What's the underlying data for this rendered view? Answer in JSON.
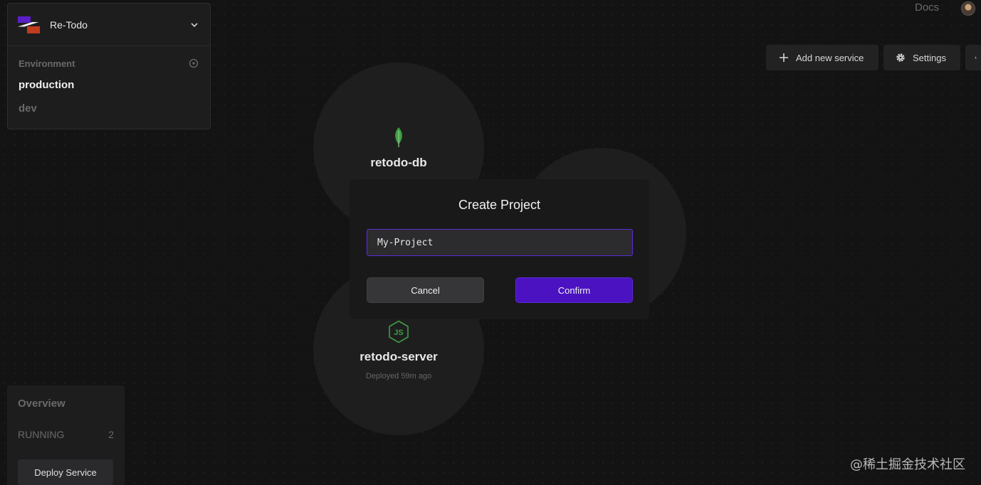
{
  "project": {
    "name": "Re-Todo"
  },
  "environment": {
    "label": "Environment",
    "items": [
      "production",
      "dev"
    ]
  },
  "header": {
    "docs": "Docs",
    "add_service": "Add new service",
    "settings": "Settings"
  },
  "canvas": {
    "db_node": {
      "name": "retodo-db",
      "icon": "mongodb-leaf-icon"
    },
    "server_node": {
      "name": "retodo-server",
      "status": "Deployed 59m ago",
      "icon": "nodejs-icon"
    }
  },
  "modal": {
    "title": "Create Project",
    "input_value": "My-Project",
    "cancel": "Cancel",
    "confirm": "Confirm"
  },
  "overview": {
    "title": "Overview",
    "running_label": "RUNNING",
    "running_count": "2",
    "deploy_button": "Deploy Service"
  },
  "watermark": "@稀土掘金技术社区",
  "colors": {
    "accent": "#4a12c0",
    "input_border": "#5b2bd6",
    "background": "#141314"
  }
}
